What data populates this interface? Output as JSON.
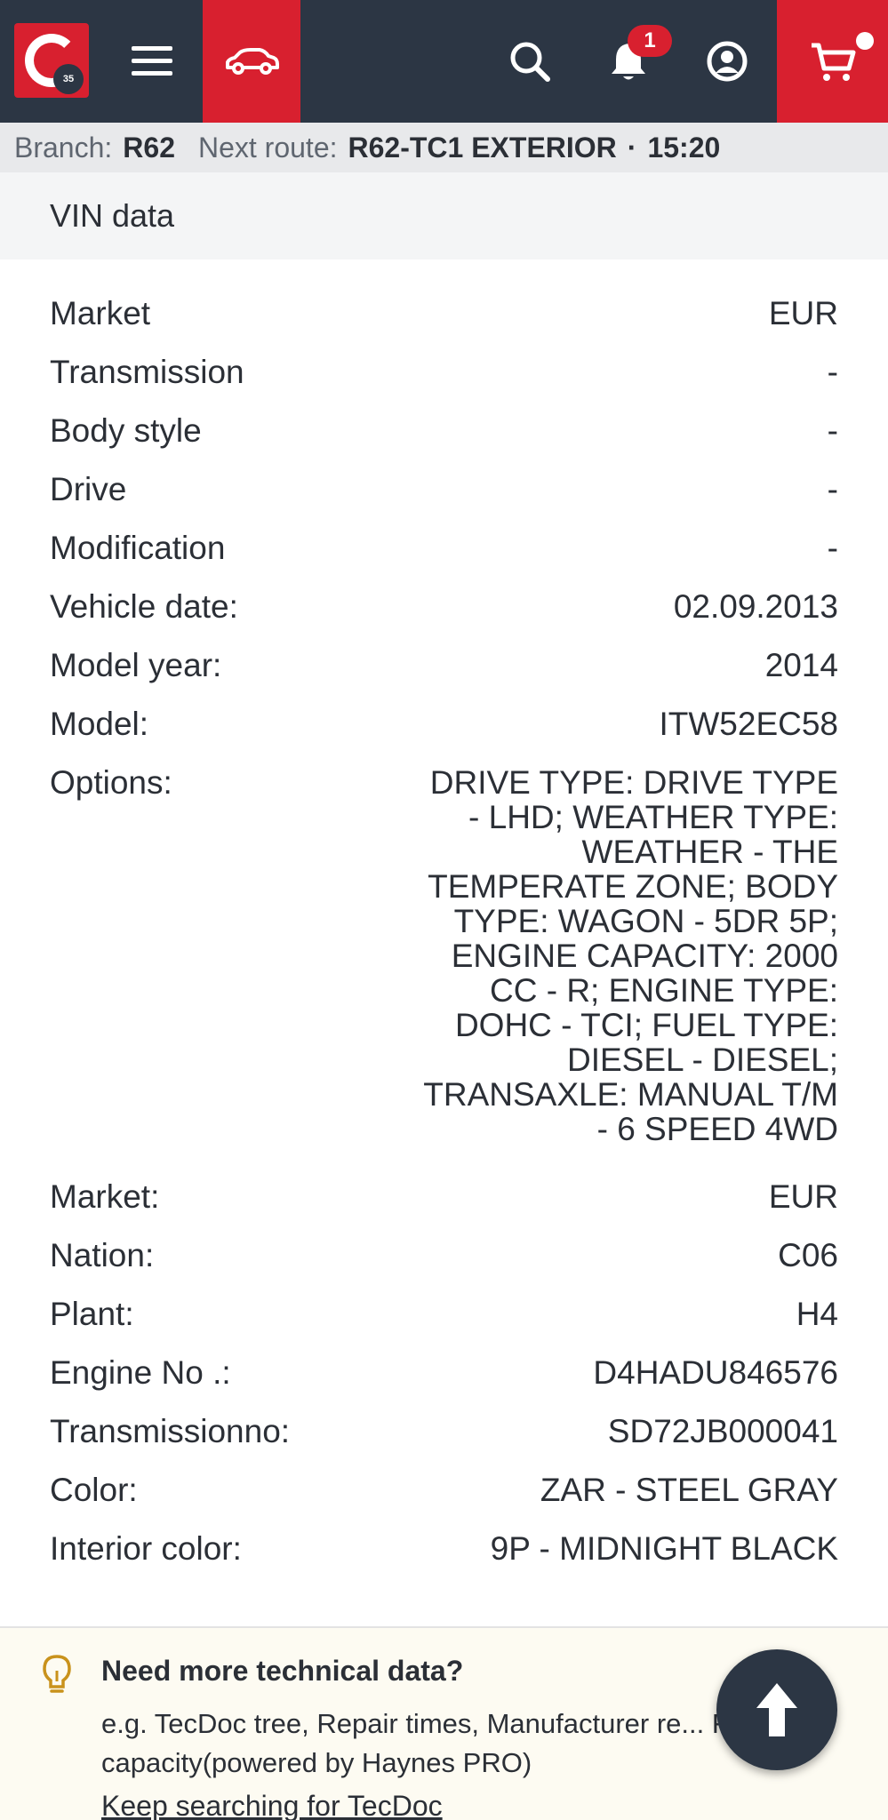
{
  "header": {
    "logo_badge": "35",
    "notification_count": "1",
    "icons": [
      "hamburger-icon",
      "car-icon",
      "search-icon",
      "bell-icon",
      "user-icon",
      "cart-icon"
    ]
  },
  "branch": {
    "branch_label": "Branch:",
    "branch_value": "R62",
    "route_label": "Next route:",
    "route_value": "R62-TC1 EXTERIOR",
    "separator": "·",
    "route_time": "15:20"
  },
  "section": {
    "title": "VIN data"
  },
  "vin_rows": [
    {
      "label": "Market",
      "value": "EUR"
    },
    {
      "label": "Transmission",
      "value": "-"
    },
    {
      "label": "Body style",
      "value": "-"
    },
    {
      "label": "Drive",
      "value": "-"
    },
    {
      "label": "Modification",
      "value": "-"
    },
    {
      "label": "Vehicle date:",
      "value": "02.09.2013"
    },
    {
      "label": "Model year:",
      "value": "2014"
    },
    {
      "label": "Model:",
      "value": "ITW52EC58"
    },
    {
      "label": "Options:",
      "value": "DRIVE TYPE: DRIVE TYPE - LHD; WEATHER TYPE: WEATHER - THE TEMPERATE ZONE; BODY TYPE: WAGON - 5DR 5P; ENGINE CAPACITY: 2000 CC - R; ENGINE TYPE: DOHC - TCI; FUEL TYPE: DIESEL - DIESEL; TRANSAXLE: MANUAL T/M - 6 SPEED 4WD"
    },
    {
      "label": "Market:",
      "value": "EUR"
    },
    {
      "label": "Nation:",
      "value": "C06"
    },
    {
      "label": "Plant:",
      "value": "H4"
    },
    {
      "label": "Engine No .:",
      "value": "D4HADU846576"
    },
    {
      "label": "Transmissionno:",
      "value": "SD72JB000041"
    },
    {
      "label": "Color:",
      "value": "ZAR - STEEL GRAY"
    },
    {
      "label": "Interior color:",
      "value": "9P - MIDNIGHT BLACK"
    }
  ],
  "tip": {
    "title": "Need more technical data?",
    "description": "e.g. TecDoc tree, Repair times, Manufacturer re... Fluids capacity(powered by Haynes PRO)",
    "link": "Keep searching for TecDoc"
  },
  "colors": {
    "nav_bg": "#2c3644",
    "accent_red": "#d8202f",
    "strip_bg": "#e8e9eb",
    "tip_bg": "#fdfbf2"
  }
}
